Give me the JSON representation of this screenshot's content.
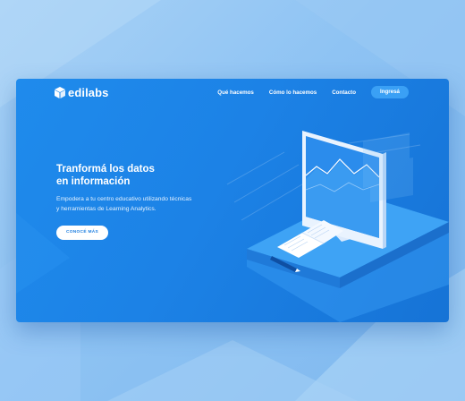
{
  "nav": {
    "logo_text": "edilabs",
    "links": [
      "Qué hacemos",
      "Cómo lo hacemos",
      "Contacto"
    ],
    "cta_label": "Ingresá"
  },
  "hero": {
    "title_lines": [
      "Tranformá los datos",
      "en información"
    ],
    "subtitle_lines": [
      "Empodera a tu centro educativo utilizando técnicas",
      "y herramientas de Learning Analytics."
    ],
    "button_label": "CONOCÉ MÁS"
  },
  "colors": {
    "page_background": "#8ec3f3",
    "card_background": "#1c82e6",
    "nav_button": "#3aa0f5",
    "hero_button": "#ffffff",
    "hero_button_text": "#1f7fe0"
  },
  "illustration": {
    "name": "isometric-desk-monitor-chart",
    "elements": [
      "monitor",
      "line-chart",
      "open-book",
      "pencil",
      "desk-platform"
    ]
  }
}
